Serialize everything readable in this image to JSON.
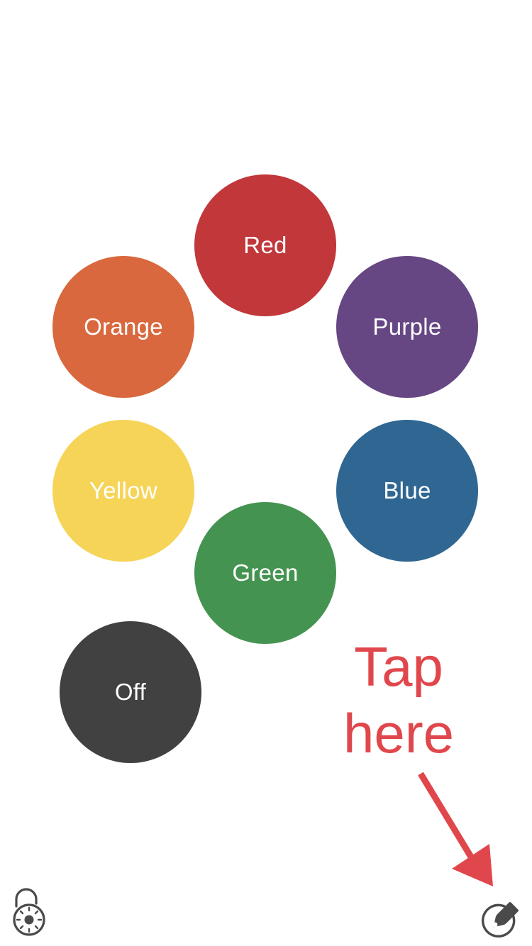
{
  "colors_grid": {
    "buttons": [
      {
        "label": "Red",
        "color": "#c1373a"
      },
      {
        "label": "Orange",
        "color": "#d9683e"
      },
      {
        "label": "Purple",
        "color": "#664683"
      },
      {
        "label": "Yellow",
        "color": "#f6d458"
      },
      {
        "label": "Blue",
        "color": "#306792"
      },
      {
        "label": "Green",
        "color": "#459351"
      },
      {
        "label": "Off",
        "color": "#414142"
      }
    ]
  },
  "annotation": {
    "line1": "Tap",
    "line2": "here",
    "color": "#e0474c"
  },
  "toolbar": {
    "lock_icon": "unlocked-padlock-icon",
    "edit_icon": "edit-pencil-icon",
    "icon_color": "#4a4a4a"
  }
}
